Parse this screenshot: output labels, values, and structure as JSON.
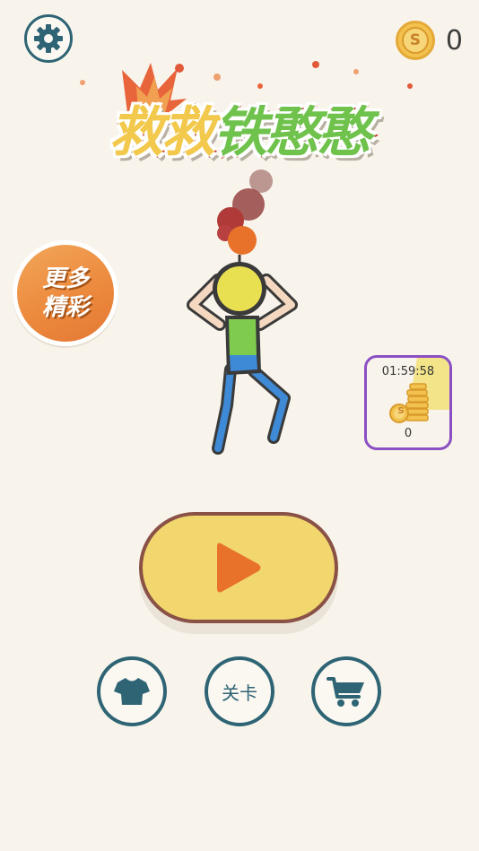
{
  "header": {
    "coins": "0",
    "coin_symbol": "S"
  },
  "title": {
    "part1": "救救",
    "part2": "铁憨憨"
  },
  "more_games": {
    "line1": "更多",
    "line2": "精彩"
  },
  "timer_reward": {
    "time": "01:59:58",
    "amount": "0",
    "coin_symbol": "S"
  },
  "bottom_nav": {
    "skins_icon": "tshirt-icon",
    "levels_label": "关卡",
    "shop_icon": "cart-icon"
  },
  "colors": {
    "teal": "#2e6474",
    "background": "#f8f4ec",
    "play": "#f1d76e",
    "purple_border": "#8b4fc3"
  }
}
